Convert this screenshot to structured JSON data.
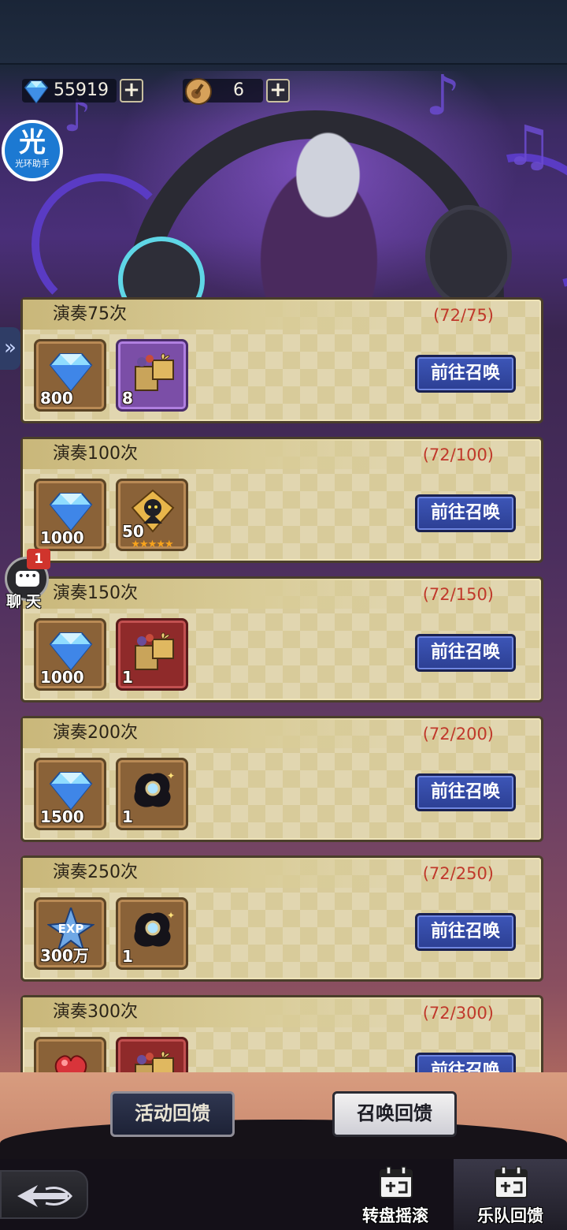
{
  "currency": {
    "diamonds": {
      "icon": "diamond-icon",
      "value": "55919"
    },
    "tickets": {
      "icon": "guitar-ticket-icon",
      "value": "6"
    },
    "add_symbol": "+"
  },
  "halo_assistant": {
    "glyph": "光",
    "label": "光环助手"
  },
  "side_tab": {
    "glyph": "»"
  },
  "rewards": [
    {
      "title": "演奏75次",
      "progress": "(72/75)",
      "button": "前往召唤",
      "items": [
        {
          "icon": "diamond-icon",
          "frame": "bronze",
          "count": "800"
        },
        {
          "icon": "gift-box-icon",
          "frame": "purple",
          "count": "8"
        }
      ]
    },
    {
      "title": "演奏100次",
      "progress": "(72/100)",
      "button": "前往召唤",
      "items": [
        {
          "icon": "diamond-icon",
          "frame": "bronze",
          "count": "1000"
        },
        {
          "icon": "hero-shard-icon",
          "frame": "bronze",
          "count": "50",
          "stars": "★★★★★"
        }
      ]
    },
    {
      "title": "演奏150次",
      "progress": "(72/150)",
      "button": "前往召唤",
      "items": [
        {
          "icon": "diamond-icon",
          "frame": "bronze",
          "count": "1000"
        },
        {
          "icon": "gift-box-icon",
          "frame": "red",
          "count": "1"
        }
      ]
    },
    {
      "title": "演奏200次",
      "progress": "(72/200)",
      "button": "前往召唤",
      "items": [
        {
          "icon": "diamond-icon",
          "frame": "bronze",
          "count": "1500"
        },
        {
          "icon": "shadow-creature-icon",
          "frame": "bronze",
          "count": "1"
        }
      ]
    },
    {
      "title": "演奏250次",
      "progress": "(72/250)",
      "button": "前往召唤",
      "items": [
        {
          "icon": "exp-star-icon",
          "frame": "bronze",
          "count": "300万"
        },
        {
          "icon": "shadow-creature-icon",
          "frame": "bronze",
          "count": "1"
        }
      ]
    },
    {
      "title": "演奏300次",
      "progress": "(72/300)",
      "button": "前往召唤",
      "items": [
        {
          "icon": "red-gem-icon",
          "frame": "bronze",
          "count": ""
        },
        {
          "icon": "gift-box-icon",
          "frame": "red",
          "count": ""
        }
      ]
    }
  ],
  "chat": {
    "badge": "1",
    "label": "聊天"
  },
  "bottom_buttons": {
    "activity_feedback": "活动回馈",
    "summon_feedback": "召唤回馈"
  },
  "nav": {
    "back_icon": "back-arrow-icon",
    "tabs": [
      {
        "label": "转盘摇滚",
        "icon": "calendar-icon",
        "active": false
      },
      {
        "label": "乐队回馈",
        "icon": "calendar-icon",
        "active": true
      }
    ]
  },
  "colors": {
    "progress_text": "#c0392b",
    "button_blue": "#3d56b8",
    "card_bg": "#d8cb9a"
  }
}
